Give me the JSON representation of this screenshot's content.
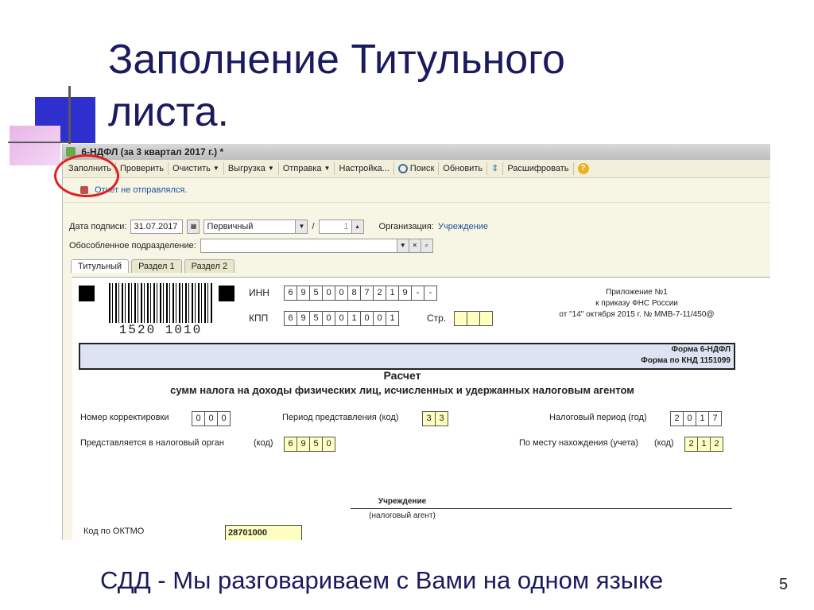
{
  "slide": {
    "title_line1": "Заполнение Титульного",
    "title_line2": "листа.",
    "footer": "СДД - Мы разговариваем с Вами на одном языке",
    "page_number": "5"
  },
  "window": {
    "title": "6-НДФЛ (за 3 квартал 2017 г.) *"
  },
  "toolbar": {
    "fill": "Заполнить",
    "check": "Проверить",
    "clear": "Очистить",
    "upload": "Выгрузка",
    "send": "Отправка",
    "settings": "Настройка...",
    "search": "Поиск",
    "refresh": "Обновить",
    "decode": "Расшифровать"
  },
  "status": {
    "text": "Отчет не отправлялся."
  },
  "header_fields": {
    "sign_date_label": "Дата подписи:",
    "sign_date_value": "31.07.2017",
    "type_value": "Первичный",
    "slash": "/",
    "correction_value": "1",
    "org_label": "Организация:",
    "org_value": "Учреждение",
    "division_label": "Обособленное подразделение:"
  },
  "tabs": [
    "Титульный",
    "Раздел 1",
    "Раздел 2"
  ],
  "form": {
    "barcode_number": "1520 1010",
    "inn_label": "ИНН",
    "inn_cells": [
      "6",
      "9",
      "5",
      "0",
      "0",
      "8",
      "7",
      "2",
      "1",
      "9",
      "-",
      "-"
    ],
    "kpp_label": "КПП",
    "kpp_cells": [
      "6",
      "9",
      "5",
      "0",
      "0",
      "1",
      "0",
      "0",
      "1"
    ],
    "page_label": "Стр.",
    "appendix_line1": "Приложение №1",
    "appendix_line2": "к приказу ФНС России",
    "appendix_line3": "от \"14\" октября 2015 г. № ММВ-7-11/450@",
    "form_name": "Форма 6-НДФЛ",
    "form_knd": "Форма по КНД 1151099",
    "calc_title": "Расчет",
    "calc_subtitle": "сумм налога на доходы физических лиц, исчисленных и удержанных налоговым агентом",
    "corr_label": "Номер корректировки",
    "corr_cells": [
      "0",
      "0",
      "0"
    ],
    "period_label": "Период представления (код)",
    "period_cells": [
      "3",
      "3"
    ],
    "tax_period_label": "Налоговый период (год)",
    "year_cells": [
      "2",
      "0",
      "1",
      "7"
    ],
    "authority_label": "Представляется в налоговый орган",
    "authority_code": "(код)",
    "authority_cells": [
      "6",
      "9",
      "5",
      "0"
    ],
    "location_label": "По месту нахождения (учета)",
    "location_code": "(код)",
    "location_cells": [
      "2",
      "1",
      "2"
    ],
    "agent_name": "Учреждение",
    "agent_caption": "(налоговый агент)",
    "oktmo_label": "Код по ОКТМО",
    "oktmo_value": "28701000"
  },
  "colors": {
    "title": "#1a1a5e",
    "highlight_circle": "#e02020",
    "link": "#1f4fa0"
  }
}
